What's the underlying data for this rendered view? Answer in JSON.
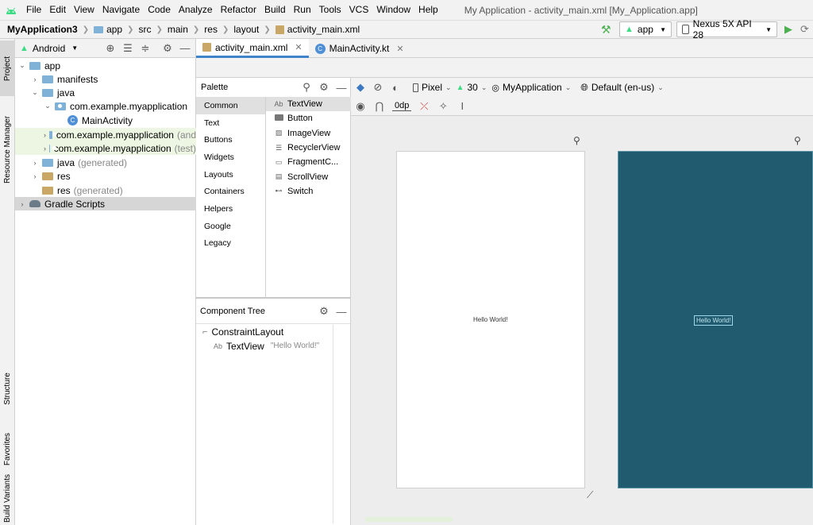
{
  "menubar": {
    "items": [
      "File",
      "Edit",
      "View",
      "Navigate",
      "Code",
      "Analyze",
      "Refactor",
      "Build",
      "Run",
      "Tools",
      "VCS",
      "Window",
      "Help"
    ],
    "window_title": "My Application - activity_main.xml [My_Application.app]"
  },
  "navbar": {
    "crumbs": [
      "MyApplication3",
      "app",
      "src",
      "main",
      "res",
      "layout",
      "activity_main.xml"
    ],
    "run_config": "app",
    "device": "Nexus 5X API 28"
  },
  "left_stripe": {
    "tabs": [
      "Project",
      "Resource Manager",
      "Structure",
      "Favorites",
      "Build Variants"
    ]
  },
  "project_panel": {
    "view_selector": "Android",
    "tree": [
      {
        "label": "app",
        "suffix": "",
        "depth": 0
      },
      {
        "label": "manifests",
        "suffix": "",
        "depth": 1
      },
      {
        "label": "java",
        "suffix": "",
        "depth": 1
      },
      {
        "label": "com.example.myapplication",
        "suffix": "",
        "depth": 2
      },
      {
        "label": "MainActivity",
        "suffix": "",
        "depth": 3
      },
      {
        "label": "com.example.myapplication",
        "suffix": "(and",
        "depth": 2
      },
      {
        "label": "com.example.myapplication",
        "suffix": "(test)",
        "depth": 2
      },
      {
        "label": "java",
        "suffix": "(generated)",
        "depth": 1
      },
      {
        "label": "res",
        "suffix": "",
        "depth": 1
      },
      {
        "label": "res",
        "suffix": "(generated)",
        "depth": 1
      },
      {
        "label": "Gradle Scripts",
        "suffix": "",
        "depth": 0
      }
    ]
  },
  "editor_tabs": [
    {
      "label": "activity_main.xml",
      "active": true
    },
    {
      "label": "MainActivity.kt",
      "active": false
    }
  ],
  "palette": {
    "title": "Palette",
    "categories": [
      "Common",
      "Text",
      "Buttons",
      "Widgets",
      "Layouts",
      "Containers",
      "Helpers",
      "Google",
      "Legacy"
    ],
    "selected_category": "Common",
    "widgets": [
      {
        "label": "TextView",
        "icon": "Ab"
      },
      {
        "label": "Button",
        "icon": "btn-icon"
      },
      {
        "label": "ImageView",
        "icon": "image-icon"
      },
      {
        "label": "RecyclerView",
        "icon": "list-icon"
      },
      {
        "label": "FragmentC...",
        "icon": "fragment-icon"
      },
      {
        "label": "ScrollView",
        "icon": "scroll-icon"
      },
      {
        "label": "Switch",
        "icon": "switch-icon"
      }
    ]
  },
  "component_tree": {
    "title": "Component Tree",
    "root": "ConstraintLayout",
    "child_icon": "Ab",
    "child": "TextView",
    "child_text": "\"Hello World!\""
  },
  "design_toolbar": {
    "device": "Pixel",
    "api": "30",
    "theme": "MyApplication",
    "locale": "Default (en-us)",
    "margin": "0dp"
  },
  "canvas": {
    "design_text": "Hello World!",
    "blueprint_text": "Hello World!",
    "blueprint_color": "#215b6f"
  }
}
